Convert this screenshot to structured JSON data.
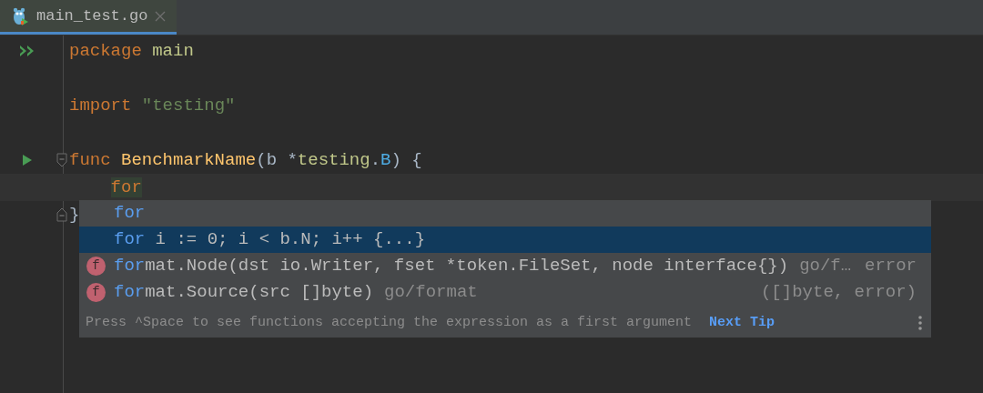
{
  "tab": {
    "title": "main_test.go",
    "selected": true
  },
  "blocks": [
    {
      "lines": [
        {
          "marker": {
            "kind": "run-all"
          },
          "tokens": [
            {
              "text": "package",
              "kind": "keyword"
            },
            {
              "text": "main",
              "kind": "package",
              "gap": true
            }
          ]
        }
      ]
    },
    {
      "lines": [
        {
          "tokens": [
            {
              "text": "import",
              "kind": "keyword"
            },
            {
              "text": "\"testing\"",
              "kind": "string",
              "gap": true
            }
          ]
        }
      ]
    },
    {
      "lines": [
        {
          "marker": {
            "kind": "run"
          },
          "fold": {
            "kind": "start"
          },
          "tokens": [
            {
              "text": "func",
              "kind": "keyword"
            },
            {
              "text": "BenchmarkName",
              "kind": "function",
              "gap": true
            },
            {
              "text": "(b *",
              "kind": "plain"
            },
            {
              "text": "testing",
              "kind": "package"
            },
            {
              "text": ".",
              "kind": "plain"
            },
            {
              "text": "B",
              "kind": "type"
            },
            {
              "text": ") {",
              "kind": "plain"
            }
          ]
        },
        {
          "current": true,
          "indented": true,
          "tokens": [
            {
              "text": "for",
              "kind": "typed"
            }
          ]
        },
        {
          "fold": {
            "kind": "end"
          },
          "tokens": [
            {
              "text": "}",
              "kind": "plain"
            }
          ]
        }
      ]
    }
  ],
  "completion": {
    "items": [
      {
        "match": "for",
        "selected": false
      },
      {
        "match": "for",
        "rest": " i := 0; i < b.N; i++ {...}",
        "selected": true
      },
      {
        "icon": "f",
        "match": "for",
        "rest": "mat.Node(dst io.Writer, fset *token.FileSet, node interface{})",
        "location": "go/f…",
        "type": "error",
        "selected": false
      },
      {
        "icon": "f",
        "match": "for",
        "rest": "mat.Source(src []byte)",
        "location": "go/format",
        "type": "([]byte, error)",
        "selected": false
      }
    ],
    "hint": "Press ^Space to see functions accepting the expression as a first argument",
    "link": "Next Tip"
  }
}
